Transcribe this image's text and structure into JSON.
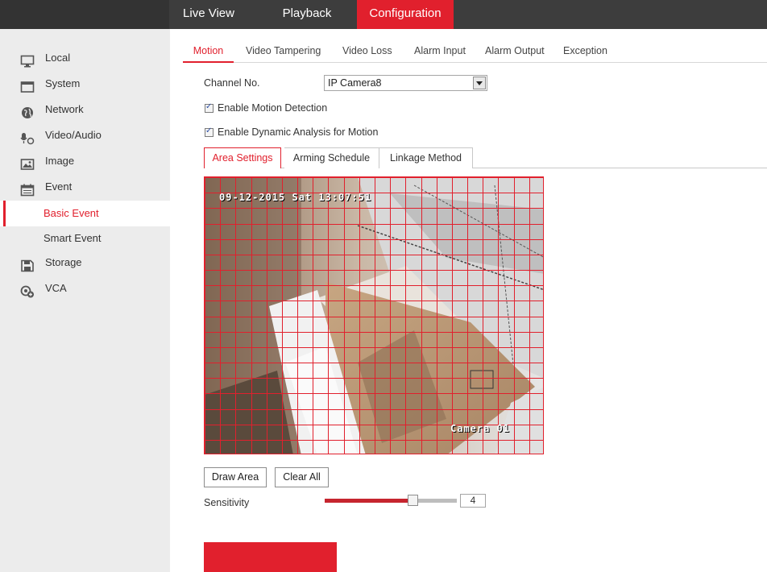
{
  "topnav": {
    "live_view": "Live View",
    "playback": "Playback",
    "configuration": "Configuration"
  },
  "sidebar": {
    "items": [
      {
        "label": "Local",
        "icon": "monitor-icon"
      },
      {
        "label": "System",
        "icon": "system-window-icon"
      },
      {
        "label": "Network",
        "icon": "globe-icon"
      },
      {
        "label": "Video/Audio",
        "icon": "microphone-icon"
      },
      {
        "label": "Image",
        "icon": "image-icon"
      },
      {
        "label": "Event",
        "icon": "calendar-icon"
      },
      {
        "label": "Basic Event",
        "icon": ""
      },
      {
        "label": "Smart Event",
        "icon": ""
      },
      {
        "label": "Storage",
        "icon": "floppy-disk-icon"
      },
      {
        "label": "VCA",
        "icon": "vca-icon"
      }
    ],
    "selected": "Basic Event"
  },
  "tabs": [
    "Motion",
    "Video Tampering",
    "Video Loss",
    "Alarm Input",
    "Alarm Output",
    "Exception"
  ],
  "active_tab": "Motion",
  "form": {
    "channel_label": "Channel No.",
    "channel_value": "IP Camera8",
    "enable_motion": "Enable Motion Detection",
    "enable_dynamic": "Enable Dynamic Analysis for Motion",
    "enable_motion_checked": true,
    "enable_dynamic_checked": true
  },
  "subtabs": [
    "Area Settings",
    "Arming Schedule",
    "Linkage Method"
  ],
  "active_subtab": "Area Settings",
  "video": {
    "timestamp": "09-12-2015 Sat 13:07:51",
    "camera_name": "Camera 01",
    "grid_color": "#e1202d"
  },
  "buttons": {
    "draw_area": "Draw Area",
    "clear_all": "Clear All"
  },
  "sensitivity": {
    "label": "Sensitivity",
    "value": "4",
    "max": 6
  },
  "colors": {
    "accent": "#e1202d",
    "topbar": "#3d3d3d",
    "sidebar": "#ececec"
  }
}
